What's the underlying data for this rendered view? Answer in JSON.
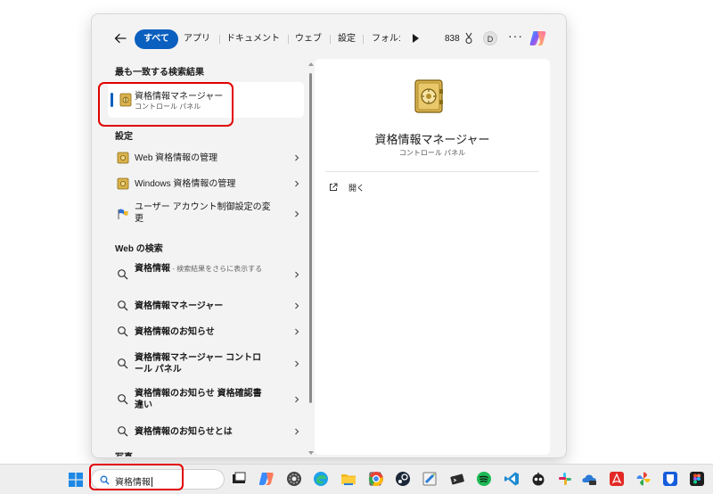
{
  "filters": {
    "tabs": [
      {
        "label": "すべて",
        "active": true
      },
      {
        "label": "アプリ"
      },
      {
        "label": "ドキュメント"
      },
      {
        "label": "ウェブ"
      },
      {
        "label": "設定"
      },
      {
        "label": "フォル:"
      }
    ],
    "points": "838",
    "avatar_letter": "D",
    "more": "···"
  },
  "results": {
    "best_match_heading": "最も一致する検索結果",
    "best_match": {
      "title": "資格情報マネージャー",
      "subtitle": "コントロール パネル"
    },
    "settings_heading": "設定",
    "settings": [
      {
        "label": "Web 資格情報の管理",
        "icon": "credential-vault-icon"
      },
      {
        "label": "Windows 資格情報の管理",
        "icon": "credential-vault-icon"
      },
      {
        "label": "ユーザー アカウント制御設定の変更",
        "icon": "uac-flag-icon"
      }
    ],
    "web_heading": "Web の検索",
    "web": [
      {
        "label": "資格情報",
        "hint": " - 検索結果をさらに表示する"
      },
      {
        "label": "資格情報マネージャー"
      },
      {
        "label": "資格情報のお知らせ"
      },
      {
        "label": "資格情報マネージャー コントロール パネル"
      },
      {
        "label": "資格情報のお知らせ 資格確認書違い"
      },
      {
        "label": "資格情報のお知らせとは"
      }
    ],
    "photos_heading": "写真"
  },
  "preview": {
    "title": "資格情報マネージャー",
    "subtitle": "コントロール パネル",
    "open_label": "開く"
  },
  "taskbar": {
    "search_text": "資格情報",
    "apps": [
      "terminal",
      "copilot",
      "chrome-dev",
      "edge",
      "file-explorer",
      "notepad",
      "chrome",
      "steam",
      "notepad-plus",
      "wsl",
      "spotify",
      "vscode",
      "ai-bot",
      "slack",
      "onedrive",
      "acrobat",
      "lens",
      "bitwarden",
      "figma"
    ]
  },
  "colors": {
    "accent": "#0a5fbf",
    "annotation": "#e20000"
  }
}
